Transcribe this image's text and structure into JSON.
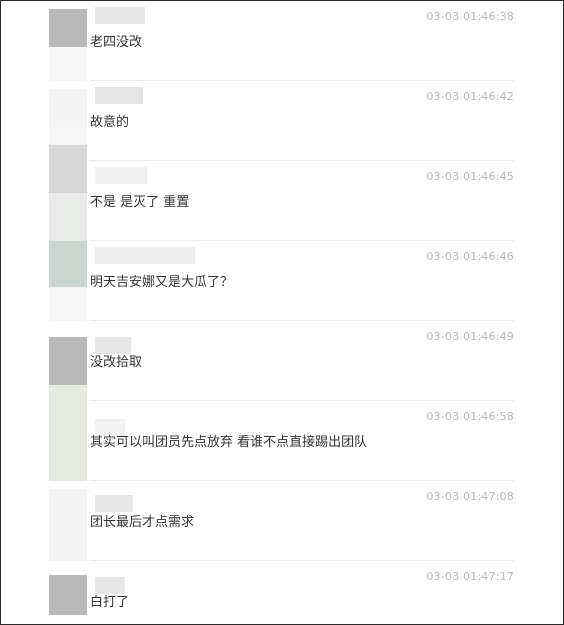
{
  "comments": [
    {
      "time": "03-03 01:46:38",
      "text": "老四没改"
    },
    {
      "time": "03-03 01:46:42",
      "text": "故意的"
    },
    {
      "time": "03-03 01:46:45",
      "text": "不是  是灭了 重置"
    },
    {
      "time": "03-03 01:46:46",
      "text": "明天吉安娜又是大瓜了？"
    },
    {
      "time": "03-03 01:46:49",
      "text": "没改拾取"
    },
    {
      "time": "03-03 01:46:58",
      "text": "其实可以叫团员先点放弃  看谁不点直接踢出团队"
    },
    {
      "time": "03-03 01:47:08",
      "text": "团长最后才点需求"
    },
    {
      "time": "03-03 01:47:17",
      "text": "白打了"
    }
  ]
}
